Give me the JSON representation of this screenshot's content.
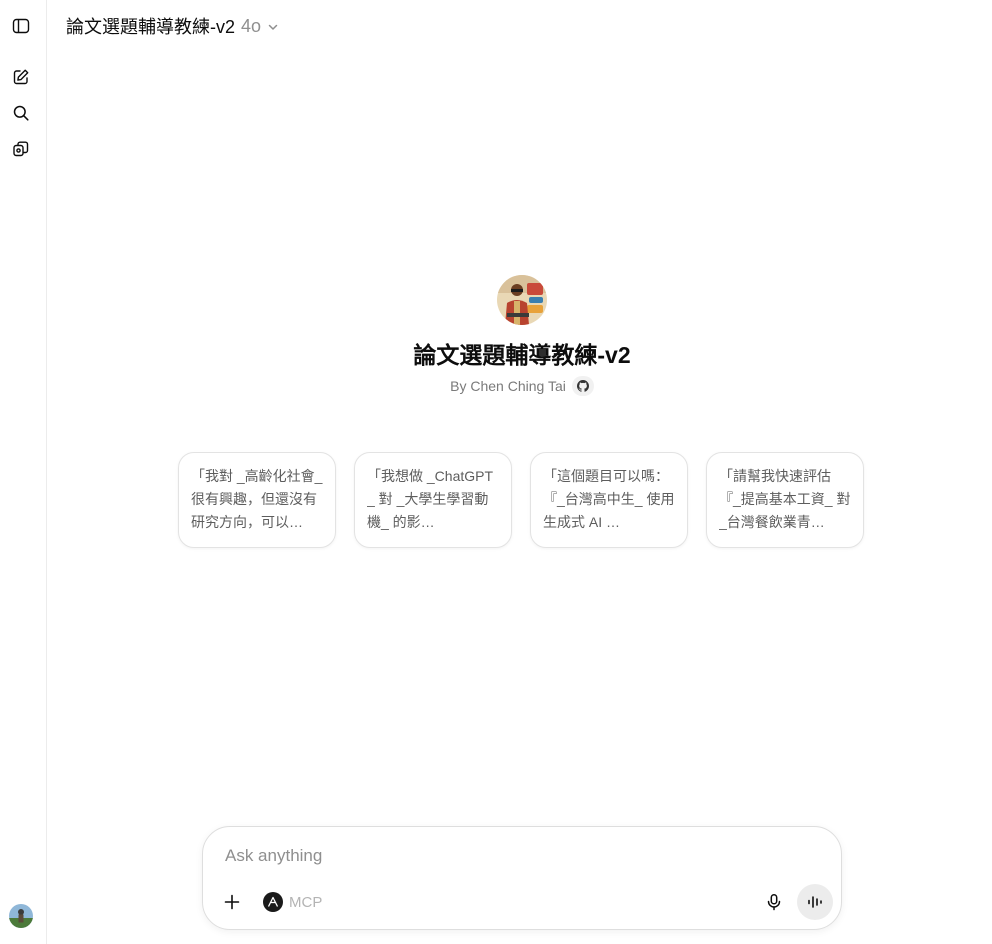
{
  "header": {
    "title": "論文選題輔導教練-v2",
    "model": "4o"
  },
  "rail": {
    "icons": [
      "sidebar-toggle-icon",
      "new-chat-icon",
      "search-icon",
      "gpts-icon"
    ]
  },
  "gpt": {
    "name": "論文選題輔導教練-v2",
    "author": "By Chen Ching Tai"
  },
  "starters": [
    {
      "text": "「我對 _高齡化社會_ 很有興趣，但還沒有研究方向，可以…"
    },
    {
      "text": "「我想做 _ChatGPT_ 對 _大學生學習動機_ 的影…"
    },
    {
      "text": "「這個題目可以嗎：『_台灣高中生_ 使用生成式 AI …"
    },
    {
      "text": "「請幫我快速評估『_提高基本工資_ 對 _台灣餐飲業青…"
    }
  ],
  "composer": {
    "placeholder": "Ask anything",
    "mcp_label": "MCP"
  },
  "colors": {
    "text": "#0d0d0d",
    "muted": "#8f8f8f",
    "border": "#e3e3e3"
  }
}
